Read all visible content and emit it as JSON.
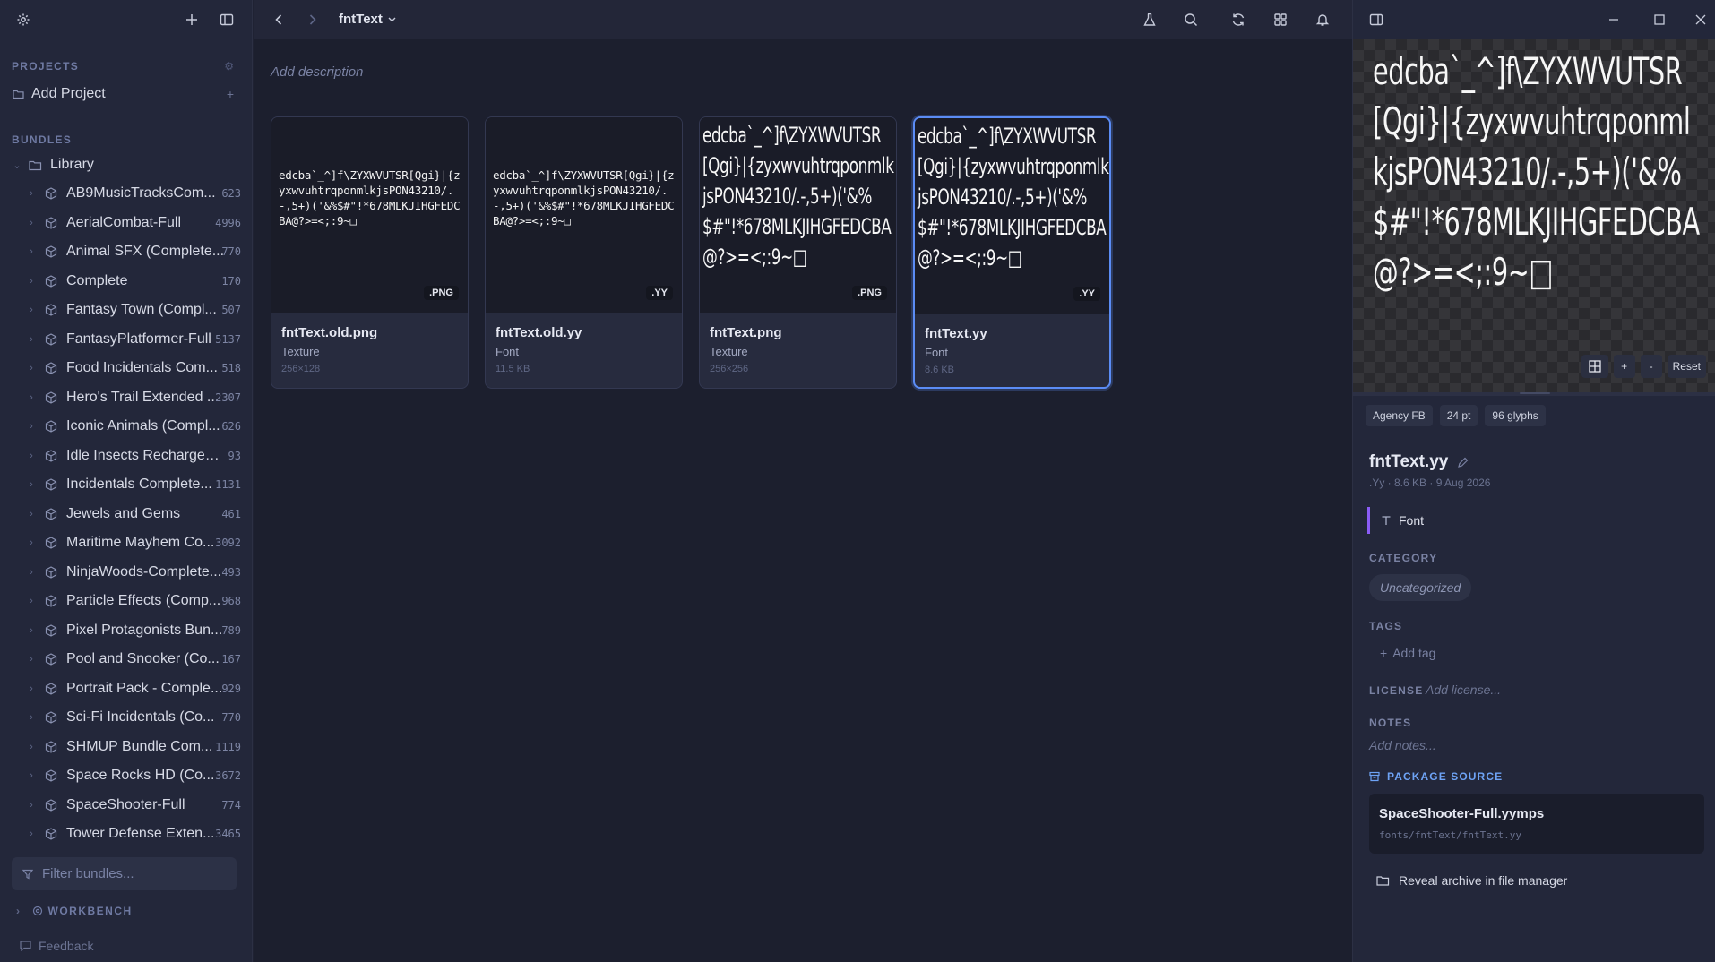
{
  "sidebar": {
    "projects_heading": "PROJECTS",
    "add_project": "Add Project",
    "bundles_heading": "BUNDLES",
    "library": "Library",
    "bundles": [
      {
        "name": "AB9MusicTracksCom...",
        "count": "623"
      },
      {
        "name": "AerialCombat-Full",
        "count": "4996"
      },
      {
        "name": "Animal SFX (Complete...",
        "count": "770"
      },
      {
        "name": "Complete",
        "count": "170"
      },
      {
        "name": "Fantasy Town (Compl...",
        "count": "507"
      },
      {
        "name": "FantasyPlatformer-Full",
        "count": "5137"
      },
      {
        "name": "Food Incidentals Com...",
        "count": "518"
      },
      {
        "name": "Hero's Trail Extended ...",
        "count": "2307"
      },
      {
        "name": "Iconic Animals (Compl...",
        "count": "626"
      },
      {
        "name": "Idle Insects Recharged ...",
        "count": "93"
      },
      {
        "name": "Incidentals Complete...",
        "count": "1131"
      },
      {
        "name": "Jewels and Gems",
        "count": "461"
      },
      {
        "name": "Maritime Mayhem Co...",
        "count": "3092"
      },
      {
        "name": "NinjaWoods-Complete...",
        "count": "493"
      },
      {
        "name": "Particle Effects (Comp...",
        "count": "968"
      },
      {
        "name": "Pixel Protagonists Bun...",
        "count": "789"
      },
      {
        "name": "Pool and Snooker (Co...",
        "count": "167"
      },
      {
        "name": "Portrait Pack - Comple...",
        "count": "929"
      },
      {
        "name": "Sci-Fi Incidentals (Co...",
        "count": "770"
      },
      {
        "name": "SHMUP Bundle Com...",
        "count": "1119"
      },
      {
        "name": "Space Rocks HD (Co...",
        "count": "3672"
      },
      {
        "name": "SpaceShooter-Full",
        "count": "774"
      },
      {
        "name": "Tower Defense Exten...",
        "count": "3465"
      }
    ],
    "filter_placeholder": "Filter bundles...",
    "workbench": "WORKBENCH",
    "feedback": "Feedback"
  },
  "main": {
    "breadcrumb": "fntText",
    "description_placeholder": "Add description",
    "glyphs_small": "edcba`_^]f\\ZYXWVUTSR[Qgi}|{zyxwvuhtrqponmlkjsPON43210/.-,5+)('&%$#\"!*678MLKJIHGFEDCBA@?>=<;:9~□",
    "glyphs_big": "edcba`_^]f\\ZYXWVUTSR[Qgi}|{zyxwvuhtrqponmlkjsPON43210/.-,5+)('&%$#\"!*678MLKJIHGFEDCBA@?>=<;:9~□",
    "cards": [
      {
        "name": "fntText.old.png",
        "type": "Texture",
        "meta": "256×128",
        "ext": ".PNG"
      },
      {
        "name": "fntText.old.yy",
        "type": "Font",
        "meta": "11.5 KB",
        "ext": ".YY"
      },
      {
        "name": "fntText.png",
        "type": "Texture",
        "meta": "256×256",
        "ext": ".PNG"
      },
      {
        "name": "fntText.yy",
        "type": "Font",
        "meta": "8.6 KB",
        "ext": ".YY"
      }
    ]
  },
  "inspector": {
    "preview_glyphs": "edcba`_^]f\\ZYXWVUTSR[Qgi}|{zyxwvuhtrqponmlkjsPON43210/.-,5+)('&%$#\"!*678MLKJIHGFEDCBA@?>=<;:9~□",
    "zoom_in": "+",
    "zoom_out": "-",
    "reset": "Reset",
    "chips": [
      "Agency FB",
      "24 pt",
      "96 glyphs"
    ],
    "file_name": "fntText.yy",
    "file_sub": ".Yy · 8.6 KB · 9 Aug 2026",
    "type_label": "Font",
    "category_label": "CATEGORY",
    "category_value": "Uncategorized",
    "tags_label": "TAGS",
    "add_tag": "Add tag",
    "license_label": "LICENSE",
    "license_placeholder": "Add license...",
    "notes_label": "NOTES",
    "notes_placeholder": "Add notes...",
    "package_label": "PACKAGE SOURCE",
    "package_name": "SpaceShooter-Full.yymps",
    "package_path": "fonts/fntText/fntText.yy",
    "reveal": "Reveal archive in file manager"
  },
  "colors": {
    "accent": "#5b8cf5",
    "type_bar": "#8b5cf6",
    "package_heading": "#6ea3f5"
  }
}
